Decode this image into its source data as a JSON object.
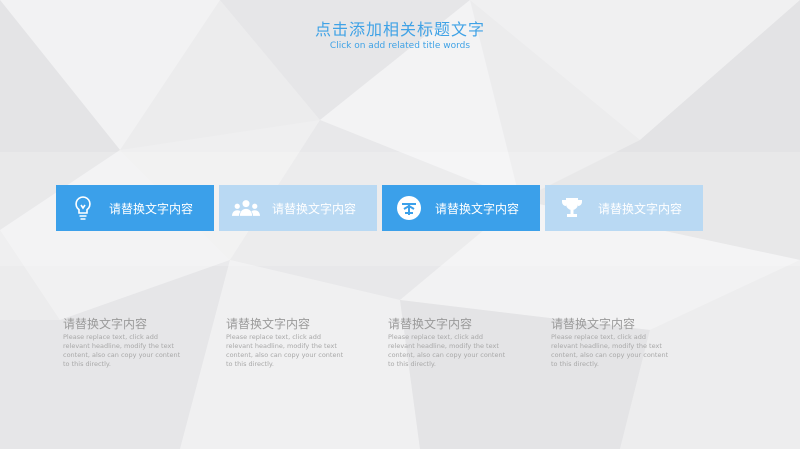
{
  "header": {
    "title": "点击添加相关标题文字",
    "subtitle": "Click on add related title words"
  },
  "cards": [
    {
      "label": "请替换文字内容",
      "icon": "lightbulb-icon",
      "style": "strong"
    },
    {
      "label": "请替换文字内容",
      "icon": "group-people-icon",
      "style": "light"
    },
    {
      "label": "请替换文字内容",
      "icon": "circle-logo-icon",
      "style": "strong"
    },
    {
      "label": "请替换文字内容",
      "icon": "trophy-icon",
      "style": "light"
    }
  ],
  "items": [
    {
      "heading": "请替换文字内容",
      "body": "Please replace text, click add relevant headline, modify the text content, also can copy your content to this directly."
    },
    {
      "heading": "请替换文字内容",
      "body": "Please replace text, click add relevant headline, modify the text content, also can copy your content to this directly."
    },
    {
      "heading": "请替换文字内容",
      "body": "Please replace text, click add relevant headline, modify the text content, also can copy your content to this directly."
    },
    {
      "heading": "请替换文字内容",
      "body": "Please replace text, click add relevant headline, modify the text content, also can copy your content to this directly."
    }
  ],
  "colors": {
    "accent": "#3ba0ea",
    "accent_light": "#b9d9f3",
    "background": "#ececed",
    "text_muted": "#9a9a9a"
  }
}
